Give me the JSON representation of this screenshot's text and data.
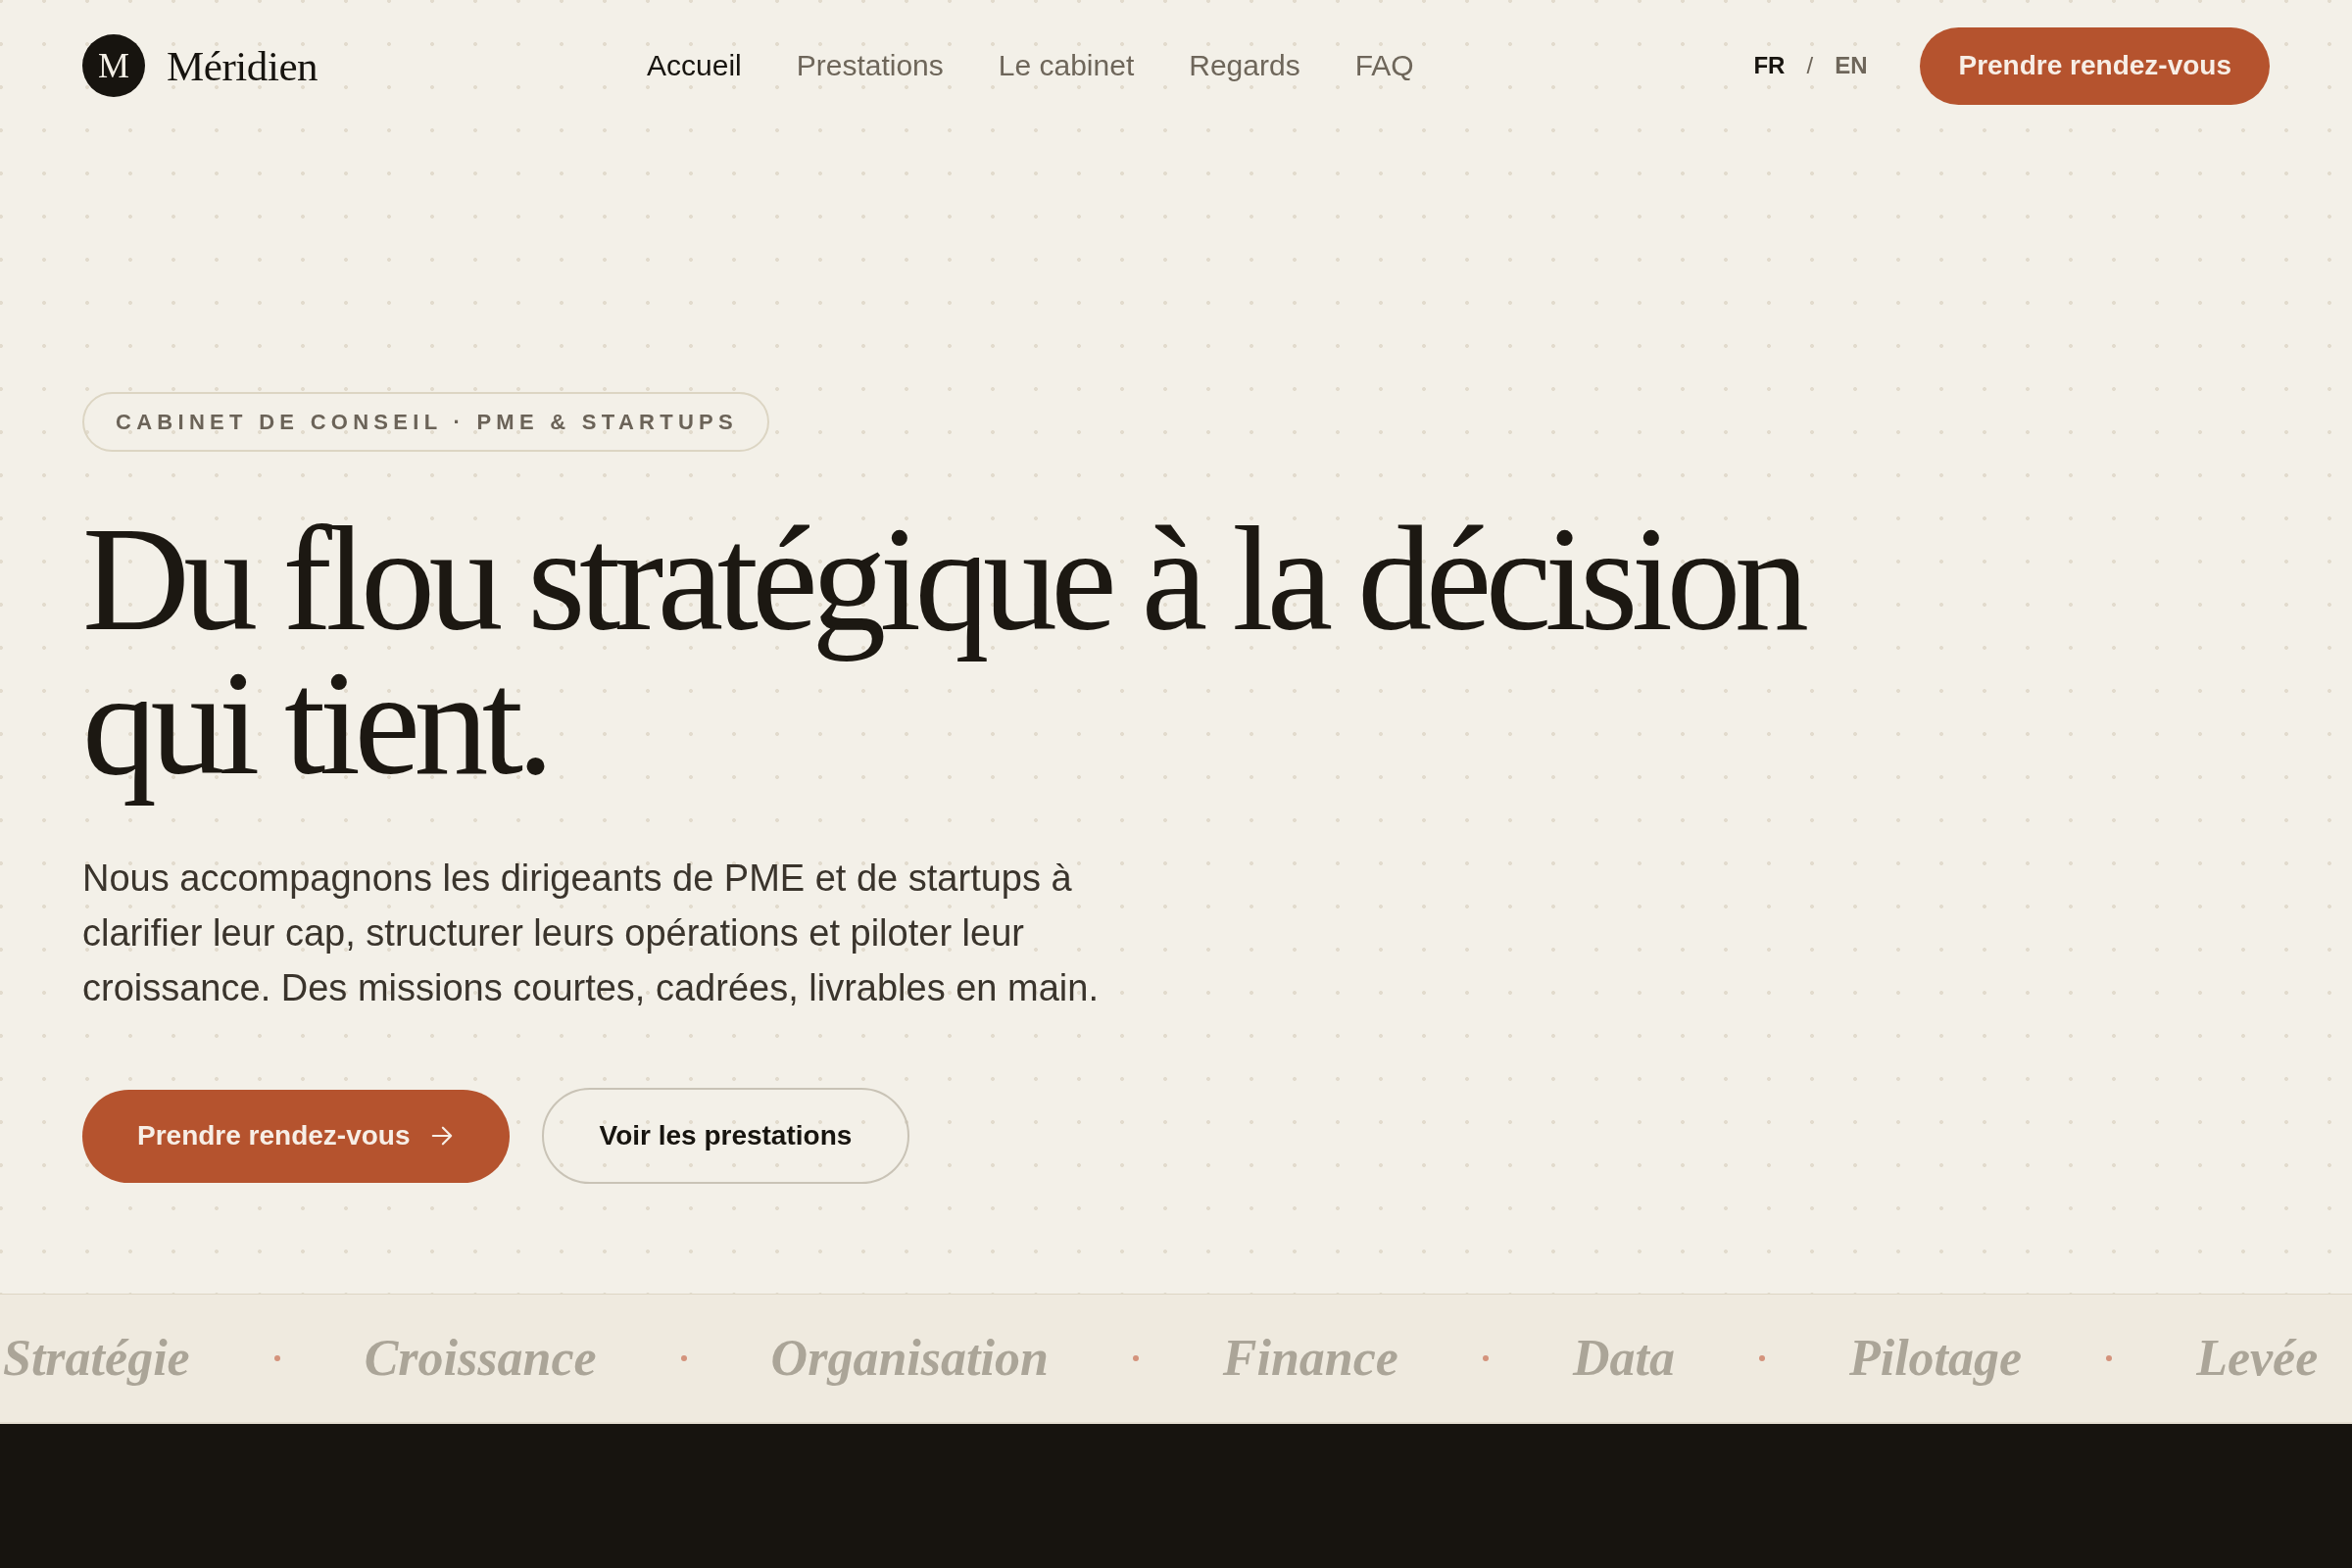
{
  "header": {
    "logo": {
      "mark": "M",
      "name": "Méridien"
    },
    "nav": [
      {
        "label": "Accueil",
        "selected": true
      },
      {
        "label": "Prestations",
        "selected": false
      },
      {
        "label": "Le cabinet",
        "selected": false
      },
      {
        "label": "Regards",
        "selected": false
      },
      {
        "label": "FAQ",
        "selected": false
      }
    ],
    "languages": [
      {
        "label": "FR",
        "selected": true
      },
      {
        "label": "EN",
        "selected": false
      }
    ],
    "language_separator": "/",
    "cta": "Prendre rendez-vous"
  },
  "hero": {
    "eyebrow": "CABINET DE CONSEIL · PME & STARTUPS",
    "title": "Du flou stratégique à la décision qui tient.",
    "description": "Nous accompagnons les dirigeants de PME et de startups à clarifier leur cap, structurer leurs opérations et piloter leur croissance. Des missions courtes, cadrées, livrables en main.",
    "buttons": [
      {
        "label": "Prendre rendez-vous",
        "kind": "primary"
      },
      {
        "label": "Voir les prestations",
        "kind": "secondary"
      }
    ]
  },
  "marquee": {
    "items": [
      "Stratégie",
      "Croissance",
      "Organisation",
      "Finance",
      "Data",
      "Pilotage",
      "Levée"
    ]
  }
}
